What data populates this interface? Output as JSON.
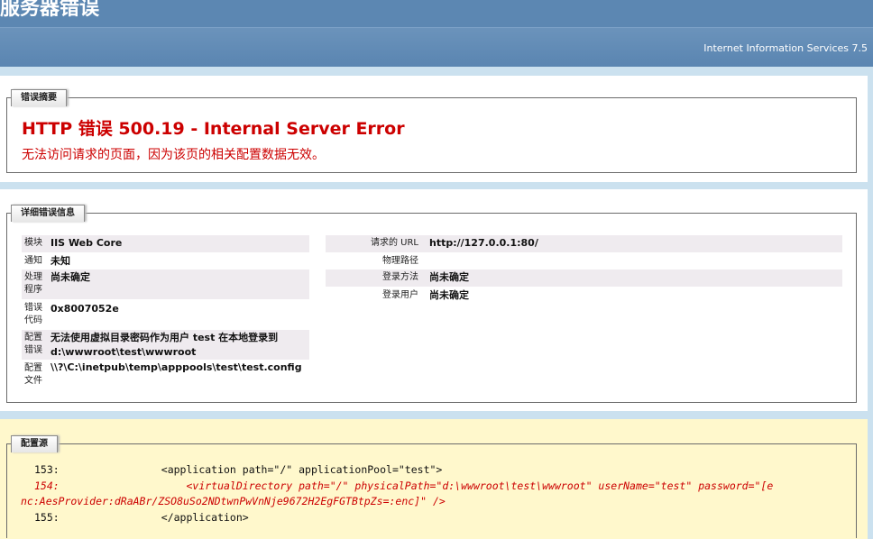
{
  "header": {
    "title": "服务器错误",
    "iis_version": "Internet Information Services 7.5"
  },
  "summary": {
    "tab_label": "错误摘要",
    "heading": "HTTP 错误 500.19 - Internal Server Error",
    "description": "无法访问请求的页面，因为该页的相关配置数据无效。"
  },
  "details": {
    "tab_label": "详细错误信息",
    "left": [
      {
        "label": "模块",
        "value": "IIS Web Core"
      },
      {
        "label": "通知",
        "value": "未知"
      },
      {
        "label": "处理程序",
        "value": "尚未确定"
      },
      {
        "label": "错误代码",
        "value": "0x8007052e"
      },
      {
        "label": "配置错误",
        "value": "无法使用虚拟目录密码作为用户 test 在本地登录到 d:\\wwwroot\\test\\wwwroot"
      },
      {
        "label": "配置文件",
        "value": "\\\\?\\C:\\inetpub\\temp\\apppools\\test\\test.config"
      }
    ],
    "right": [
      {
        "label": "请求的 URL",
        "value": "http://127.0.0.1:80/"
      },
      {
        "label": "物理路径",
        "value": ""
      },
      {
        "label": "登录方法",
        "value": "尚未确定"
      },
      {
        "label": "登录用户",
        "value": "尚未确定"
      }
    ]
  },
  "config_source": {
    "tab_label": "配置源",
    "lines": [
      {
        "num": "153:",
        "text": "                <application path=\"/\" applicationPool=\"test\">"
      },
      {
        "num": "154:",
        "text": "                    <virtualDirectory path=\"/\" physicalPath=\"d:\\wwwroot\\test\\wwwroot\" userName=\"test\" password=\"[e"
      },
      {
        "num": "",
        "text": "nc:AesProvider:dRaABr/ZSO8uSo2NDtwnPwVnNje9672H2EgFGTBtpZs=:enc]\" />"
      },
      {
        "num": "155:",
        "text": "                </application>"
      }
    ]
  }
}
